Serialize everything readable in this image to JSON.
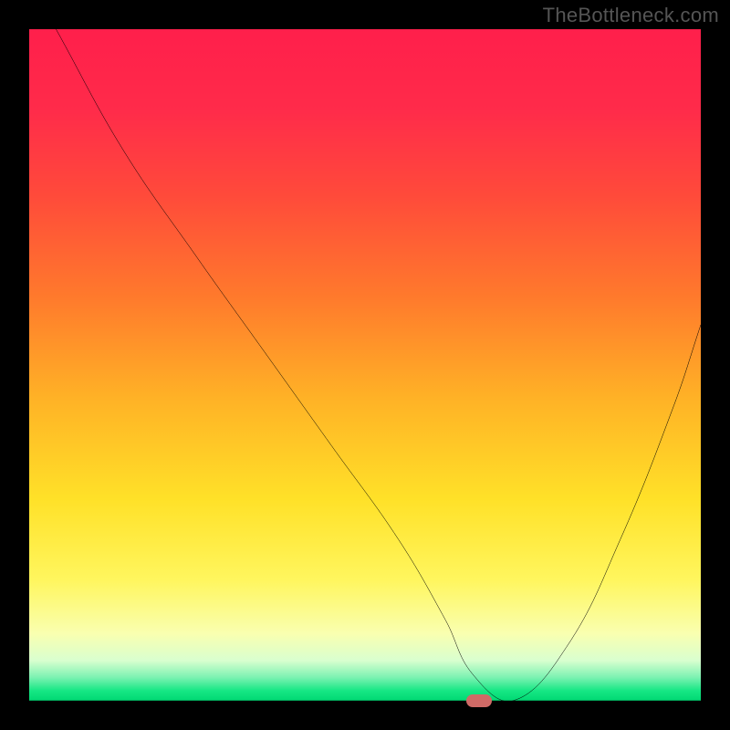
{
  "watermark": "TheBottleneck.com",
  "chart_data": {
    "type": "line",
    "title": "",
    "xlabel": "",
    "ylabel": "",
    "xlim": [
      0,
      100
    ],
    "ylim": [
      0,
      100
    ],
    "grid": false,
    "legend": false,
    "series": [
      {
        "name": "bottleneck-curve",
        "x": [
          4,
          14,
          25,
          35,
          45,
          55,
          62,
          66,
          72,
          80,
          88,
          96,
          100
        ],
        "y": [
          100,
          82,
          66,
          52,
          38,
          24,
          12,
          4,
          0,
          8,
          24,
          44,
          56
        ]
      }
    ],
    "marker": {
      "x": 67,
      "y": 0
    },
    "gradient_stops": [
      {
        "pos": 0.0,
        "color": "#ff1f4b"
      },
      {
        "pos": 0.12,
        "color": "#ff2b4a"
      },
      {
        "pos": 0.25,
        "color": "#ff4b3a"
      },
      {
        "pos": 0.4,
        "color": "#ff7a2c"
      },
      {
        "pos": 0.55,
        "color": "#ffb226"
      },
      {
        "pos": 0.7,
        "color": "#ffe128"
      },
      {
        "pos": 0.82,
        "color": "#fff65e"
      },
      {
        "pos": 0.9,
        "color": "#f9ffb0"
      },
      {
        "pos": 0.94,
        "color": "#d9ffcf"
      },
      {
        "pos": 0.965,
        "color": "#7cf2b2"
      },
      {
        "pos": 0.985,
        "color": "#16e784"
      },
      {
        "pos": 1.0,
        "color": "#00d873"
      }
    ]
  }
}
